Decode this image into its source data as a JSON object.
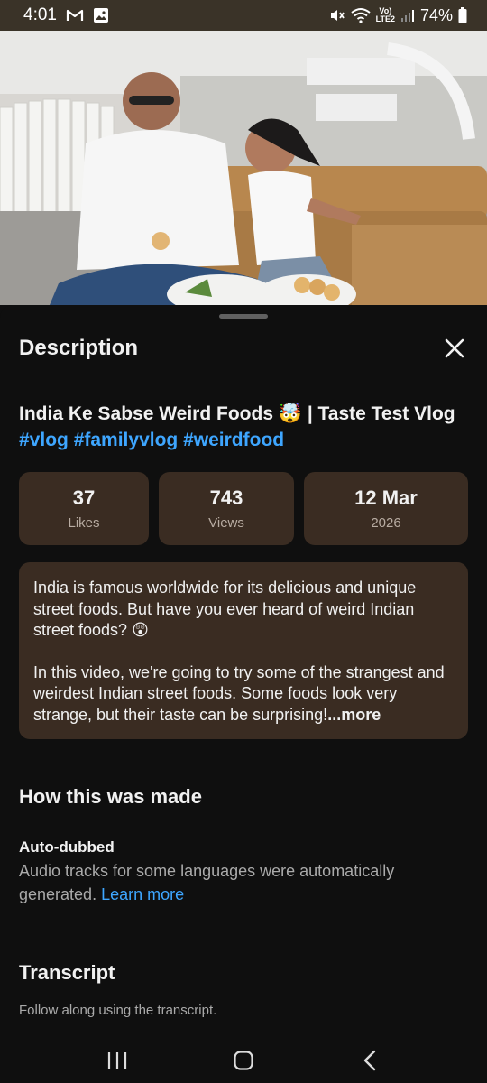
{
  "status_bar": {
    "time": "4:01",
    "battery": "74%",
    "left_icons": [
      "gmail-icon",
      "image-icon"
    ],
    "right_icons": [
      "mute-icon",
      "wifi-icon",
      "volte-icon",
      "signal-icon",
      "battery-icon"
    ],
    "network_line1": "Vo)",
    "network_line2": "LTE2"
  },
  "video": {
    "thumbnail": "video-frame"
  },
  "sheet": {
    "title": "Description",
    "close_icon": "close-icon"
  },
  "video_info": {
    "title_text": "India Ke Sabse Weird Foods 🤯 | Taste Test Vlog",
    "hashtags": [
      "#vlog",
      "#familyvlog",
      "#weirdfood"
    ],
    "stats": [
      {
        "value": "37",
        "label": "Likes"
      },
      {
        "value": "743",
        "label": "Views"
      },
      {
        "value": "12 Mar",
        "label": "2026"
      }
    ]
  },
  "description": {
    "paragraph1": "India is famous worldwide for its delicious and unique street foods. But have you ever heard of weird Indian street foods? 😲",
    "paragraph2": "In this video, we're going to try some of the strangest and weirdest Indian street foods. Some foods look very strange, but their taste can be surprising!",
    "more_label": "...more"
  },
  "how_made": {
    "title": "How this was made",
    "item_title": "Auto-dubbed",
    "item_text": "Audio tracks for some languages were automatically generated.",
    "learn_more": "Learn more"
  },
  "transcript": {
    "title": "Transcript",
    "text": "Follow along using the transcript."
  },
  "nav": {
    "recents_icon": "recents-icon",
    "home_icon": "home-icon",
    "back_icon": "back-icon"
  },
  "colors": {
    "background": "#0f0f0f",
    "card": "#3a2c22",
    "link": "#3ea6ff",
    "status_bar": "#3a3328"
  }
}
